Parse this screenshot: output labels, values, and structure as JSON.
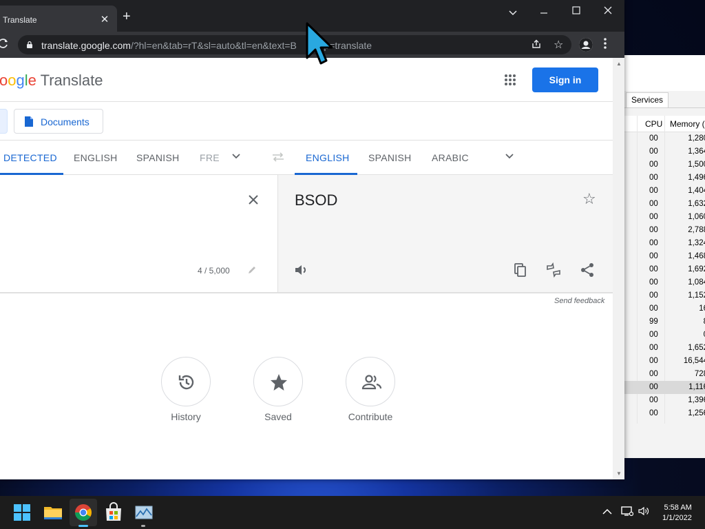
{
  "browser": {
    "tab_title": "Translate",
    "tab_close": "✕",
    "new_tab": "+",
    "url_host": "translate.google.com",
    "url_rest": "/?hl=en&tab=rT&sl=auto&tl=en&text=B",
    "url_tail": "?op=translate"
  },
  "translate": {
    "logo_app": "Translate",
    "sign_in": "Sign in",
    "documents_label": "Documents",
    "source_langs": [
      "DETECTED",
      "ENGLISH",
      "SPANISH",
      "FRE"
    ],
    "target_langs": [
      "ENGLISH",
      "SPANISH",
      "ARABIC"
    ],
    "source_text": ")",
    "char_count": "4 / 5,000",
    "target_text": "BSOD",
    "send_feedback": "Send feedback",
    "actions": [
      {
        "label": "History",
        "icon": "history-icon"
      },
      {
        "label": "Saved",
        "icon": "star-icon"
      },
      {
        "label": "Contribute",
        "icon": "people-icon"
      }
    ]
  },
  "task_manager": {
    "tab": "Services",
    "col_cpu": "CPU",
    "col_memory": "Memory (",
    "rows": [
      {
        "cpu": "00",
        "mem": "1,280"
      },
      {
        "cpu": "00",
        "mem": "1,364"
      },
      {
        "cpu": "00",
        "mem": "1,500"
      },
      {
        "cpu": "00",
        "mem": "1,496"
      },
      {
        "cpu": "00",
        "mem": "1,404"
      },
      {
        "cpu": "00",
        "mem": "1,632"
      },
      {
        "cpu": "00",
        "mem": "1,060"
      },
      {
        "cpu": "00",
        "mem": "2,788"
      },
      {
        "cpu": "00",
        "mem": "1,324"
      },
      {
        "cpu": "00",
        "mem": "1,468"
      },
      {
        "cpu": "00",
        "mem": "1,692"
      },
      {
        "cpu": "00",
        "mem": "1,084"
      },
      {
        "cpu": "00",
        "mem": "1,152"
      },
      {
        "cpu": "00",
        "mem": "16"
      },
      {
        "cpu": "99",
        "mem": "8"
      },
      {
        "cpu": "00",
        "mem": "0"
      },
      {
        "cpu": "00",
        "mem": "1,652"
      },
      {
        "cpu": "00",
        "mem": "16,544"
      },
      {
        "cpu": "00",
        "mem": "728"
      },
      {
        "cpu": "00",
        "mem": "1,116"
      },
      {
        "cpu": "00",
        "mem": "1,396"
      },
      {
        "cpu": "00",
        "mem": "1,256"
      }
    ],
    "selected_row": 19
  },
  "taskbar": {
    "time": "5:58 AM",
    "date": "1/1/2022"
  },
  "colors": {
    "accent": "#1a73e8",
    "active_lang": "#1967d2",
    "cursor": "#29a8e0"
  }
}
